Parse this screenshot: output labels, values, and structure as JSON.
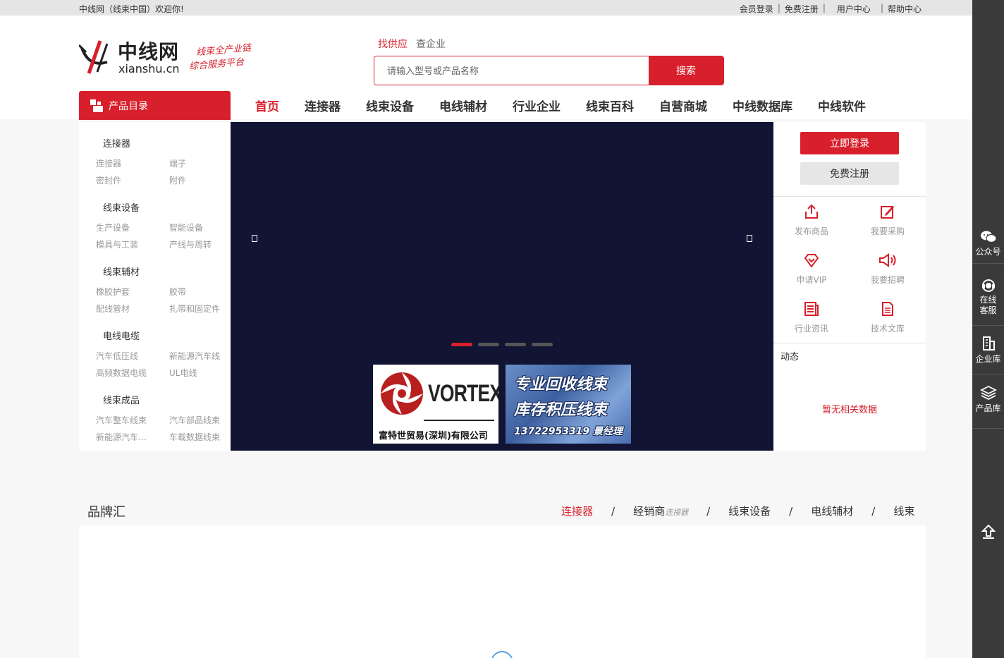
{
  "topbar": {
    "welcome": "中线网（线束中国）欢迎你!",
    "links": [
      "会员登录",
      "免费注册",
      "用户中心",
      "帮助中心"
    ]
  },
  "logo": {
    "name": "中线网",
    "domain": "xianshu.cn",
    "slogan_line1": "线束全产业链",
    "slogan_line2": "综合服务平台"
  },
  "search": {
    "tabs": [
      "找供应",
      "查企业"
    ],
    "placeholder": "请输入型号或产品名称",
    "button": "搜索"
  },
  "catalog": {
    "label": "产品目录",
    "groups": [
      {
        "title": "连接器",
        "items": [
          "连接器",
          "端子",
          "密封件",
          "附件"
        ]
      },
      {
        "title": "线束设备",
        "items": [
          "生产设备",
          "智能设备",
          "模具与工装",
          "产线与周转"
        ]
      },
      {
        "title": "线束辅材",
        "items": [
          "橡胶护套",
          "胶带",
          "配线管材",
          "扎带和固定件"
        ]
      },
      {
        "title": "电线电缆",
        "items": [
          "汽车低压线",
          "新能源汽车线",
          "高频数据电缆",
          "UL电线"
        ]
      },
      {
        "title": "线束成品",
        "items": [
          "汽车整车线束",
          "汽车部品线束",
          "新能源汽车线束",
          "车载数据线束"
        ]
      }
    ]
  },
  "nav": {
    "items": [
      "首页",
      "连接器",
      "线束设备",
      "电线辅材",
      "行业企业",
      "线束百科",
      "自营商城",
      "中线数据库",
      "中线软件"
    ],
    "active": "首页"
  },
  "banner": {
    "prev_glyph": "‹",
    "next_glyph": "›",
    "slide_count": 4,
    "active_slide": 1,
    "ad1": {
      "brand": "VORTEX",
      "company": "富特世贸易(深圳)有限公司"
    },
    "ad2": {
      "line1": "专业回收线束",
      "line2": "库存积压线束",
      "line3": "13722953319 景经理"
    }
  },
  "account": {
    "login": "立即登录",
    "register": "免费注册",
    "quick": [
      {
        "label": "发布商品",
        "icon": "share-upload-icon"
      },
      {
        "label": "我要采购",
        "icon": "edit-icon"
      },
      {
        "label": "申请VIP",
        "icon": "vip-diamond-icon"
      },
      {
        "label": "我要招聘",
        "icon": "megaphone-icon"
      },
      {
        "label": "行业资讯",
        "icon": "news-icon"
      },
      {
        "label": "技术文库",
        "icon": "document-icon"
      }
    ],
    "news_title": "动态",
    "no_data": "暂无相关数据"
  },
  "brands": {
    "title": "品牌汇",
    "tabs": [
      {
        "label": "连接器",
        "active": true
      },
      {
        "label": "经销商",
        "suffix": "连接器"
      },
      {
        "label": "线束设备"
      },
      {
        "label": "电线辅材"
      },
      {
        "label": "线束"
      }
    ]
  },
  "sidebar": {
    "items": [
      "公众号",
      "在线客服",
      "企业库",
      "产品库"
    ]
  },
  "colors": {
    "accent": "#d7202b",
    "banner_bg": "#111432",
    "sidebar_bg": "#3a3a3a"
  }
}
